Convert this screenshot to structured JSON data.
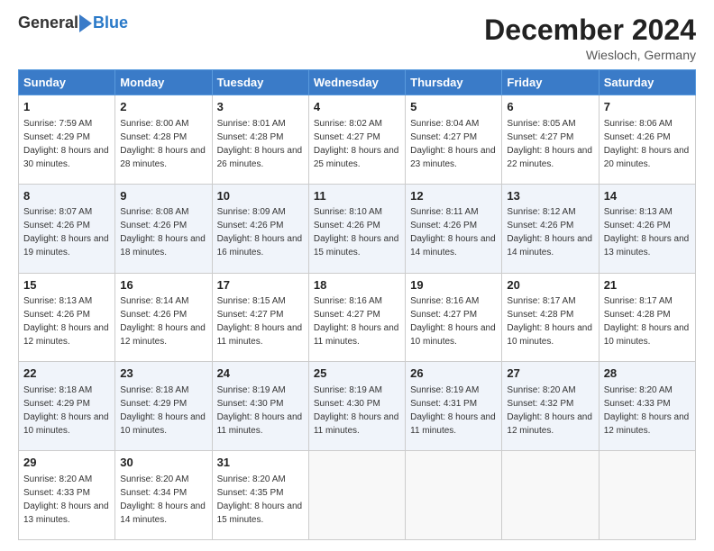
{
  "logo": {
    "general": "General",
    "blue": "Blue"
  },
  "header": {
    "month": "December 2024",
    "location": "Wiesloch, Germany"
  },
  "weekdays": [
    "Sunday",
    "Monday",
    "Tuesday",
    "Wednesday",
    "Thursday",
    "Friday",
    "Saturday"
  ],
  "weeks": [
    [
      {
        "day": "1",
        "sunrise": "7:59 AM",
        "sunset": "4:29 PM",
        "daylight": "8 hours and 30 minutes."
      },
      {
        "day": "2",
        "sunrise": "8:00 AM",
        "sunset": "4:28 PM",
        "daylight": "8 hours and 28 minutes."
      },
      {
        "day": "3",
        "sunrise": "8:01 AM",
        "sunset": "4:28 PM",
        "daylight": "8 hours and 26 minutes."
      },
      {
        "day": "4",
        "sunrise": "8:02 AM",
        "sunset": "4:27 PM",
        "daylight": "8 hours and 25 minutes."
      },
      {
        "day": "5",
        "sunrise": "8:04 AM",
        "sunset": "4:27 PM",
        "daylight": "8 hours and 23 minutes."
      },
      {
        "day": "6",
        "sunrise": "8:05 AM",
        "sunset": "4:27 PM",
        "daylight": "8 hours and 22 minutes."
      },
      {
        "day": "7",
        "sunrise": "8:06 AM",
        "sunset": "4:26 PM",
        "daylight": "8 hours and 20 minutes."
      }
    ],
    [
      {
        "day": "8",
        "sunrise": "8:07 AM",
        "sunset": "4:26 PM",
        "daylight": "8 hours and 19 minutes."
      },
      {
        "day": "9",
        "sunrise": "8:08 AM",
        "sunset": "4:26 PM",
        "daylight": "8 hours and 18 minutes."
      },
      {
        "day": "10",
        "sunrise": "8:09 AM",
        "sunset": "4:26 PM",
        "daylight": "8 hours and 16 minutes."
      },
      {
        "day": "11",
        "sunrise": "8:10 AM",
        "sunset": "4:26 PM",
        "daylight": "8 hours and 15 minutes."
      },
      {
        "day": "12",
        "sunrise": "8:11 AM",
        "sunset": "4:26 PM",
        "daylight": "8 hours and 14 minutes."
      },
      {
        "day": "13",
        "sunrise": "8:12 AM",
        "sunset": "4:26 PM",
        "daylight": "8 hours and 14 minutes."
      },
      {
        "day": "14",
        "sunrise": "8:13 AM",
        "sunset": "4:26 PM",
        "daylight": "8 hours and 13 minutes."
      }
    ],
    [
      {
        "day": "15",
        "sunrise": "8:13 AM",
        "sunset": "4:26 PM",
        "daylight": "8 hours and 12 minutes."
      },
      {
        "day": "16",
        "sunrise": "8:14 AM",
        "sunset": "4:26 PM",
        "daylight": "8 hours and 12 minutes."
      },
      {
        "day": "17",
        "sunrise": "8:15 AM",
        "sunset": "4:27 PM",
        "daylight": "8 hours and 11 minutes."
      },
      {
        "day": "18",
        "sunrise": "8:16 AM",
        "sunset": "4:27 PM",
        "daylight": "8 hours and 11 minutes."
      },
      {
        "day": "19",
        "sunrise": "8:16 AM",
        "sunset": "4:27 PM",
        "daylight": "8 hours and 10 minutes."
      },
      {
        "day": "20",
        "sunrise": "8:17 AM",
        "sunset": "4:28 PM",
        "daylight": "8 hours and 10 minutes."
      },
      {
        "day": "21",
        "sunrise": "8:17 AM",
        "sunset": "4:28 PM",
        "daylight": "8 hours and 10 minutes."
      }
    ],
    [
      {
        "day": "22",
        "sunrise": "8:18 AM",
        "sunset": "4:29 PM",
        "daylight": "8 hours and 10 minutes."
      },
      {
        "day": "23",
        "sunrise": "8:18 AM",
        "sunset": "4:29 PM",
        "daylight": "8 hours and 10 minutes."
      },
      {
        "day": "24",
        "sunrise": "8:19 AM",
        "sunset": "4:30 PM",
        "daylight": "8 hours and 11 minutes."
      },
      {
        "day": "25",
        "sunrise": "8:19 AM",
        "sunset": "4:30 PM",
        "daylight": "8 hours and 11 minutes."
      },
      {
        "day": "26",
        "sunrise": "8:19 AM",
        "sunset": "4:31 PM",
        "daylight": "8 hours and 11 minutes."
      },
      {
        "day": "27",
        "sunrise": "8:20 AM",
        "sunset": "4:32 PM",
        "daylight": "8 hours and 12 minutes."
      },
      {
        "day": "28",
        "sunrise": "8:20 AM",
        "sunset": "4:33 PM",
        "daylight": "8 hours and 12 minutes."
      }
    ],
    [
      {
        "day": "29",
        "sunrise": "8:20 AM",
        "sunset": "4:33 PM",
        "daylight": "8 hours and 13 minutes."
      },
      {
        "day": "30",
        "sunrise": "8:20 AM",
        "sunset": "4:34 PM",
        "daylight": "8 hours and 14 minutes."
      },
      {
        "day": "31",
        "sunrise": "8:20 AM",
        "sunset": "4:35 PM",
        "daylight": "8 hours and 15 minutes."
      },
      null,
      null,
      null,
      null
    ]
  ],
  "labels": {
    "sunrise": "Sunrise:",
    "sunset": "Sunset:",
    "daylight": "Daylight:"
  }
}
